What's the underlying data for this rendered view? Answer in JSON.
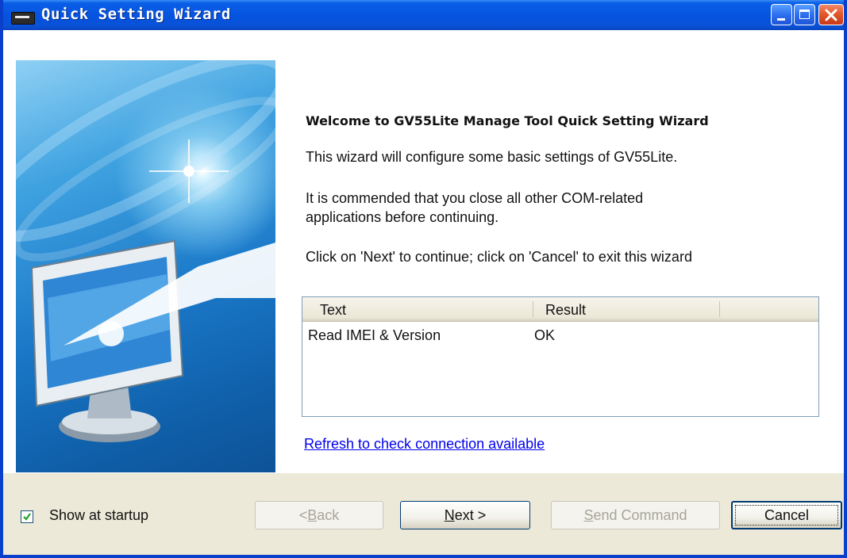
{
  "window": {
    "title": "Quick Setting Wizard",
    "colors": {
      "titlebar": "#0553df",
      "close_button": "#e25a2a",
      "footer_bg": "#ece9d8",
      "link": "#0000ee"
    }
  },
  "main": {
    "heading": "Welcome to GV55Lite Manage Tool  Quick Setting Wizard",
    "paragraph1": "This wizard will configure some basic settings of GV55Lite.",
    "paragraph2_line1": "It is commended that you close all other COM-related",
    "paragraph2_line2": "applications before continuing.",
    "paragraph3": "Click on 'Next' to continue; click on 'Cancel' to exit this wizard"
  },
  "results_table": {
    "columns": [
      "Text",
      "Result"
    ],
    "rows": [
      {
        "text": "Read IMEI & Version",
        "result": "OK"
      }
    ]
  },
  "refresh_link": "Refresh to check connection available",
  "footer": {
    "show_at_startup": "Show at startup",
    "show_at_startup_checked": true,
    "back_button": {
      "prefix": "< ",
      "mnemonic": "B",
      "rest": "ack",
      "enabled": false
    },
    "next_button": {
      "mnemonic": "N",
      "rest": "ext >",
      "enabled": true
    },
    "send_button": {
      "mnemonic": "S",
      "rest": "end Command",
      "enabled": false
    },
    "cancel_button": {
      "label": "Cancel",
      "enabled": true
    }
  },
  "icons": [
    "app-icon",
    "minimize-icon",
    "maximize-icon",
    "close-icon",
    "monitor-illustration",
    "checkmark-icon"
  ]
}
